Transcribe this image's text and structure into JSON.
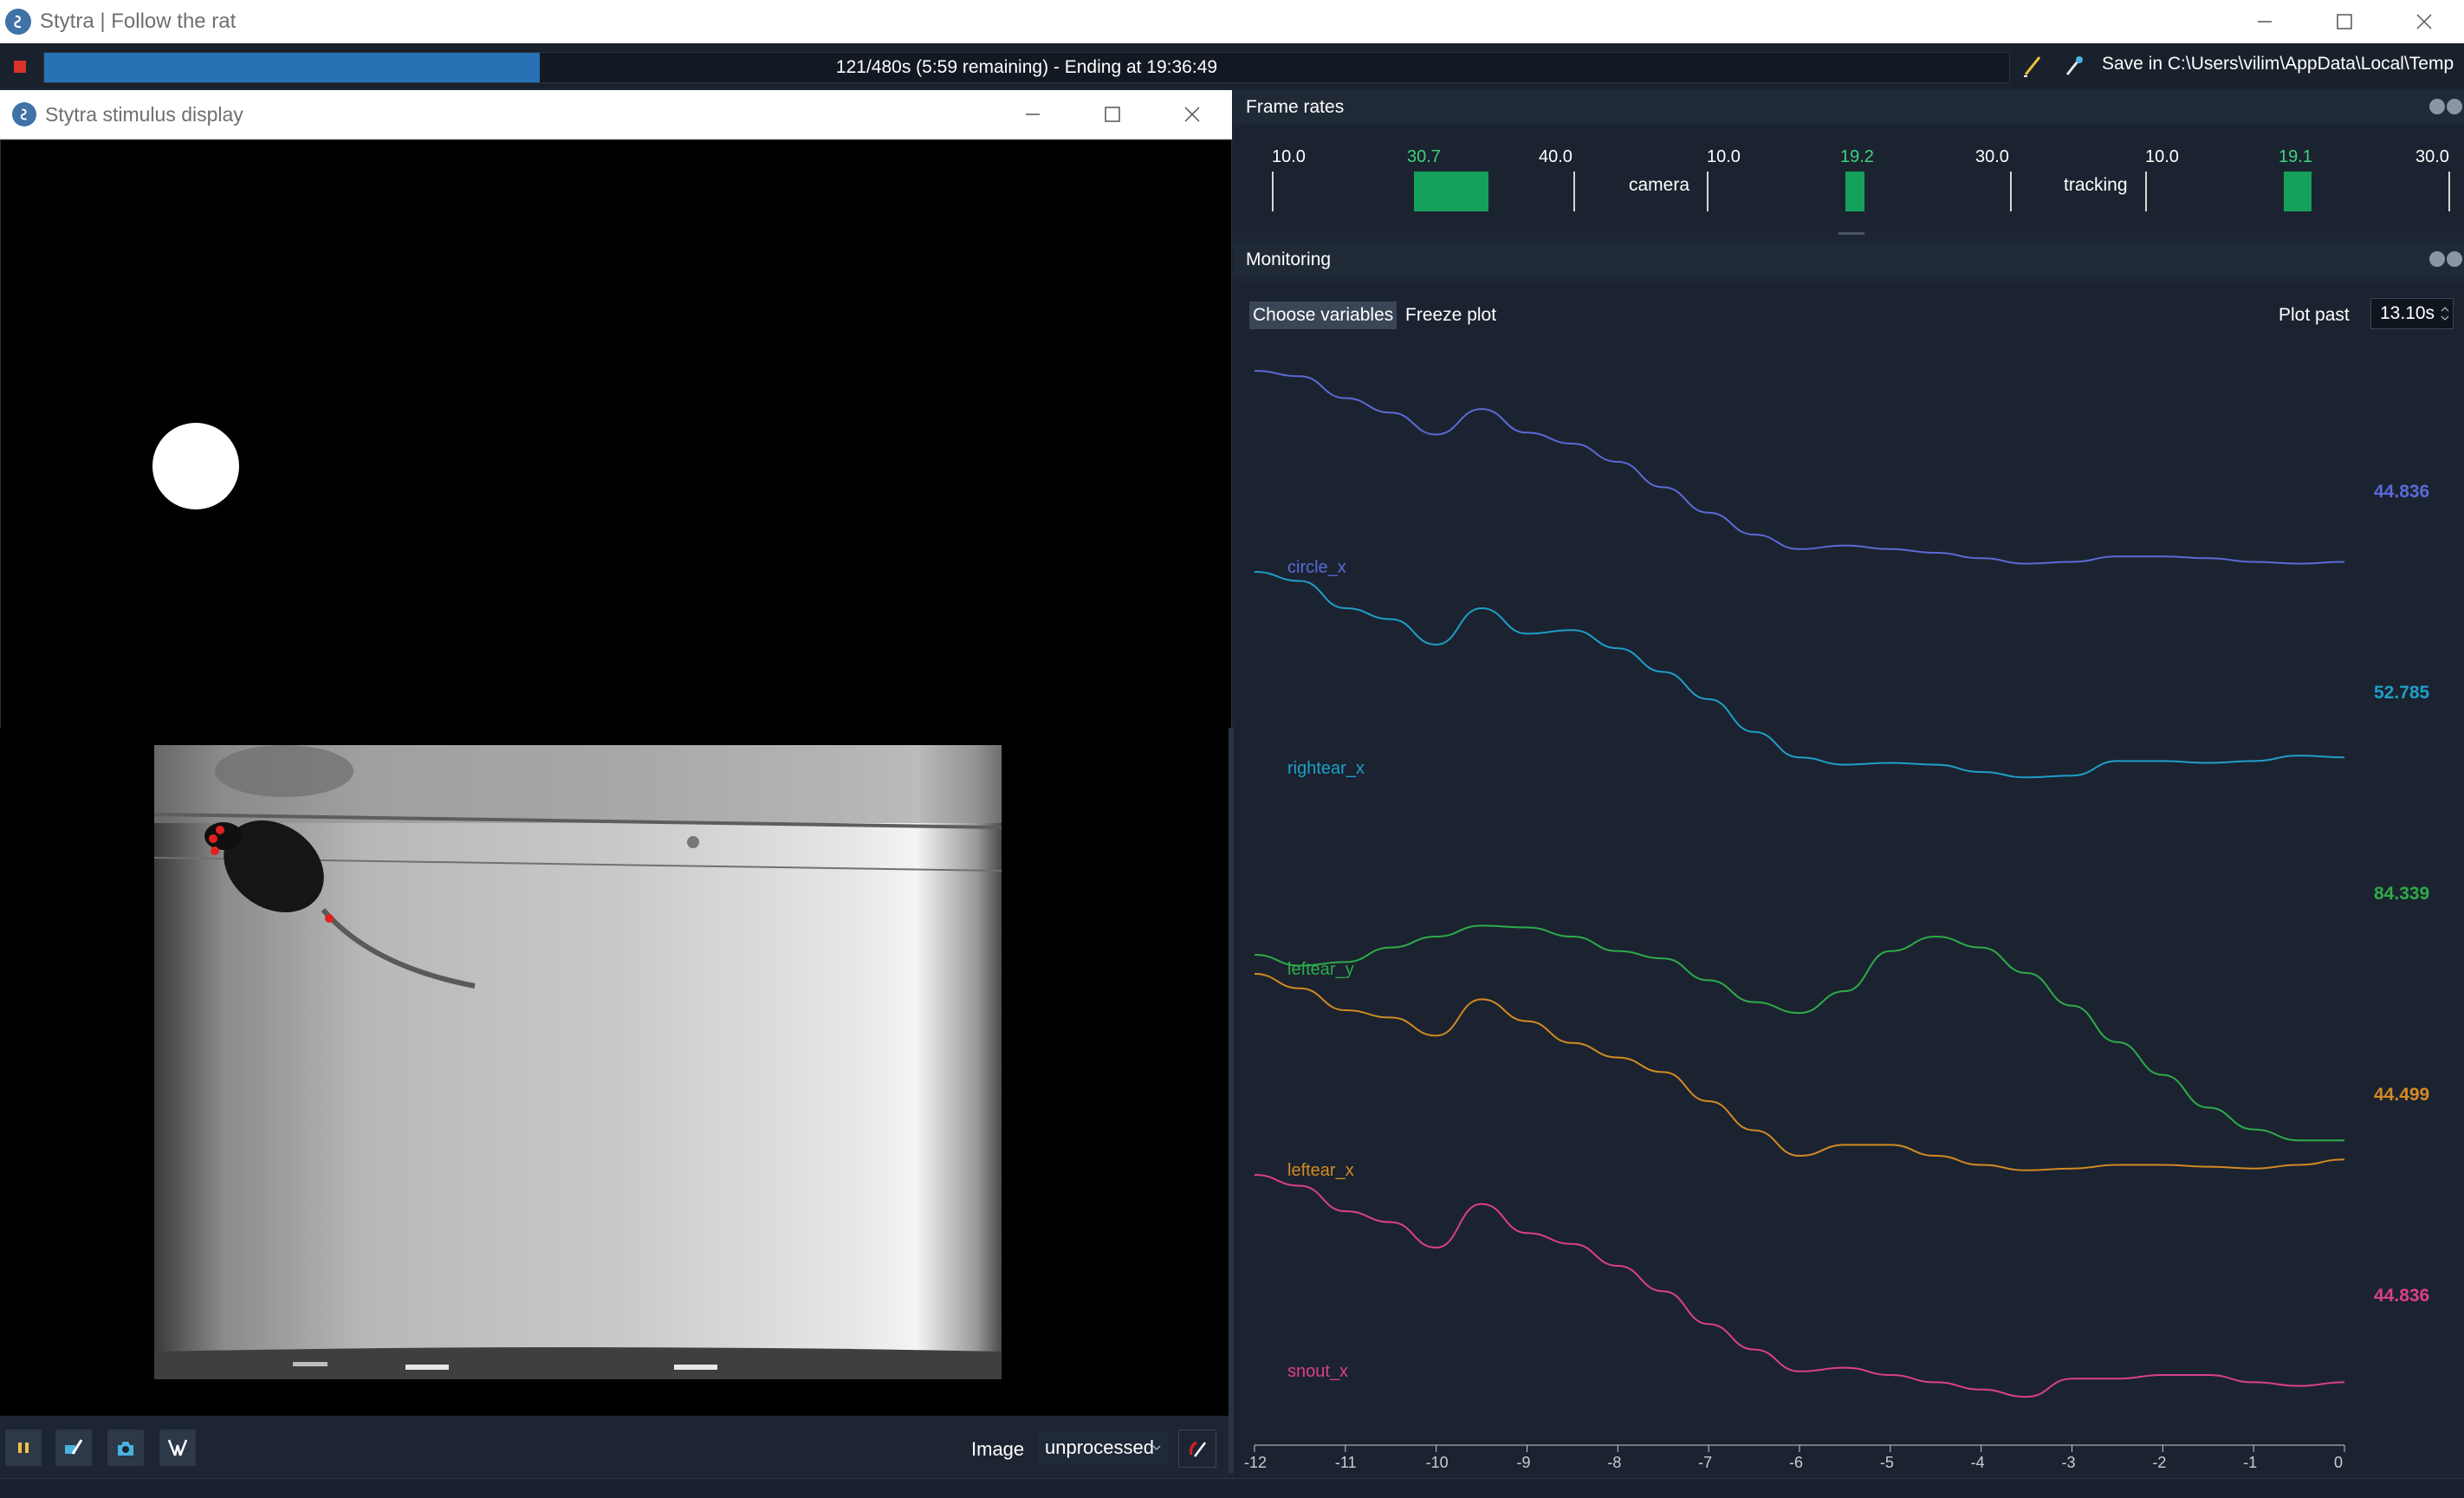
{
  "window": {
    "title": "Stytra | Follow the rat",
    "controls": [
      "minimize",
      "maximize",
      "close"
    ]
  },
  "protocol": {
    "progress": 0.252,
    "progress_text": "121/480s (5:59 remaining) - Ending at 19:36:49",
    "save_label": "Save in C:\\Users\\vilim\\AppData\\Local\\Temp",
    "stop_color": "#d9342b",
    "progress_color": "#2771b4"
  },
  "stimulus_window": {
    "title": "Stytra stimulus display"
  },
  "camera_controls": {
    "image_label": "Image",
    "image_mode": "unprocessed"
  },
  "frame_rates": {
    "title": "Frame rates",
    "gauges": [
      {
        "name": "",
        "min": "10.0",
        "max": "40.0",
        "value": "30.7"
      },
      {
        "name": "camera",
        "min": "10.0",
        "max": "30.0",
        "value": "19.2"
      },
      {
        "name": "tracking",
        "min": "10.0",
        "max": "30.0",
        "value": "19.1"
      }
    ],
    "bar_color": "#14a05a",
    "value_color": "#3ed27d"
  },
  "monitoring": {
    "title": "Monitoring",
    "choose_variables": "Choose variables",
    "freeze_plot": "Freeze plot",
    "plot_past_label": "Plot past",
    "plot_past_value": "13.10s"
  },
  "chart_data": {
    "type": "line",
    "x_ticks": [
      "-12",
      "-11",
      "-10",
      "-9",
      "-8",
      "-7",
      "-6",
      "-5",
      "-4",
      "-3",
      "-2",
      "-1",
      "0"
    ],
    "xlim": [
      -12,
      0
    ],
    "x": [
      -12,
      -11.5,
      -11,
      -10.5,
      -10,
      -9.5,
      -9,
      -8.5,
      -8,
      -7.5,
      -7,
      -6.5,
      -6,
      -5.5,
      -5,
      -4.5,
      -4,
      -3.5,
      -3,
      -2.5,
      -2,
      -1.5,
      -1,
      -0.5,
      0
    ],
    "series": [
      {
        "name": "circle_x",
        "value_label": "44.836",
        "color": "#5a6ad6",
        "y": [
          1.0,
          0.97,
          0.85,
          0.77,
          0.65,
          0.79,
          0.66,
          0.6,
          0.5,
          0.36,
          0.22,
          0.1,
          0.02,
          0.04,
          0.02,
          0.0,
          -0.03,
          -0.06,
          -0.05,
          -0.02,
          -0.02,
          -0.03,
          -0.05,
          -0.06,
          -0.05
        ]
      },
      {
        "name": "rightear_x",
        "value_label": "52.785",
        "color": "#1e9fc8",
        "y": [
          1.0,
          0.95,
          0.8,
          0.74,
          0.6,
          0.8,
          0.66,
          0.68,
          0.58,
          0.45,
          0.3,
          0.12,
          -0.02,
          -0.06,
          -0.05,
          -0.06,
          -0.1,
          -0.13,
          -0.12,
          -0.04,
          -0.04,
          -0.05,
          -0.04,
          -0.01,
          -0.02
        ]
      },
      {
        "name": "leftear_y",
        "value_label": "84.339",
        "color": "#2eab49",
        "y": [
          0.0,
          -0.06,
          -0.04,
          0.04,
          0.1,
          0.16,
          0.15,
          0.1,
          0.02,
          -0.02,
          -0.14,
          -0.26,
          -0.32,
          -0.2,
          0.02,
          0.1,
          0.04,
          -0.1,
          -0.28,
          -0.48,
          -0.66,
          -0.84,
          -0.96,
          -1.02,
          -1.02
        ]
      },
      {
        "name": "leftear_x",
        "value_label": "44.499",
        "color": "#d28a22",
        "y": [
          1.0,
          0.92,
          0.8,
          0.76,
          0.66,
          0.86,
          0.74,
          0.62,
          0.54,
          0.46,
          0.3,
          0.14,
          0.0,
          0.06,
          0.06,
          0.0,
          -0.05,
          -0.08,
          -0.07,
          -0.05,
          -0.05,
          -0.06,
          -0.07,
          -0.05,
          -0.02
        ]
      },
      {
        "name": "snout_x",
        "value_label": "44.836",
        "color": "#dc3f8c",
        "y": [
          1.0,
          0.94,
          0.8,
          0.74,
          0.6,
          0.84,
          0.68,
          0.62,
          0.5,
          0.36,
          0.18,
          0.04,
          -0.08,
          -0.06,
          -0.1,
          -0.14,
          -0.18,
          -0.22,
          -0.12,
          -0.12,
          -0.1,
          -0.1,
          -0.14,
          -0.16,
          -0.14
        ]
      }
    ]
  }
}
